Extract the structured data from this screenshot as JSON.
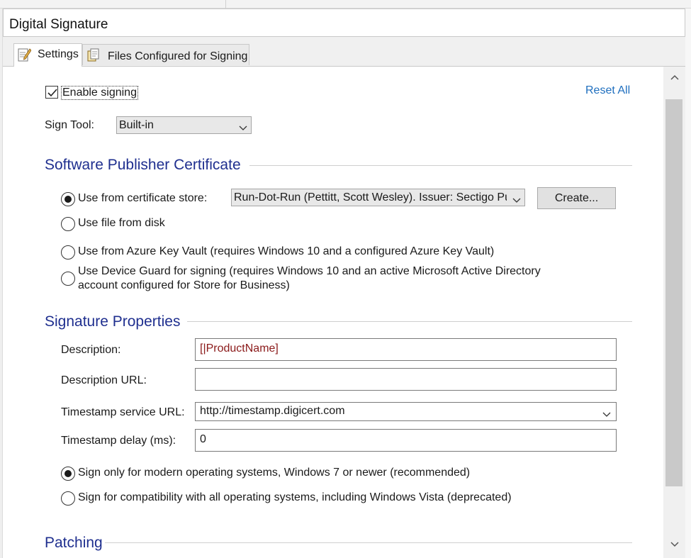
{
  "panel": {
    "title": "Digital Signature"
  },
  "tabs": [
    {
      "label": "Settings",
      "icon": "edit-document-icon"
    },
    {
      "label": "Files Configured for Signing",
      "icon": "files-icon"
    }
  ],
  "general": {
    "enable_signing_label": "Enable signing",
    "enable_signing_checked": true,
    "reset_all_label": "Reset All",
    "sign_tool_label": "Sign Tool:",
    "sign_tool_value": "Built-in"
  },
  "certificate": {
    "heading": "Software Publisher Certificate",
    "options": [
      {
        "label": "Use from certificate store:",
        "selected": true
      },
      {
        "label": "Use file from disk",
        "selected": false
      },
      {
        "label": "Use from Azure Key Vault (requires Windows 10 and a configured Azure Key Vault)",
        "selected": false
      },
      {
        "label_line1": "Use Device Guard for signing (requires Windows 10 and an active Microsoft Active Directory",
        "label_line2": "account configured for Store for Business)",
        "selected": false
      }
    ],
    "store_value": "Run-Dot-Run (Pettitt, Scott Wesley). Issuer: Sectigo Pu",
    "create_label": "Create..."
  },
  "signature": {
    "heading": "Signature Properties",
    "description_label": "Description:",
    "description_value": "[|ProductName]",
    "description_url_label": "Description URL:",
    "description_url_value": "",
    "timestamp_url_label": "Timestamp service URL:",
    "timestamp_url_value": "http://timestamp.digicert.com",
    "timestamp_delay_label": "Timestamp delay (ms):",
    "timestamp_delay_value": "0",
    "mode_options": [
      {
        "label": "Sign only for modern operating systems, Windows 7 or newer (recommended)",
        "selected": true
      },
      {
        "label": "Sign for compatibility with all operating systems, including Windows Vista (deprecated)",
        "selected": false
      }
    ]
  },
  "patching": {
    "heading": "Patching"
  },
  "colors": {
    "section_heading": "#1f2f8f",
    "link": "#1f6fbf",
    "description_text": "#8b1a1a"
  }
}
